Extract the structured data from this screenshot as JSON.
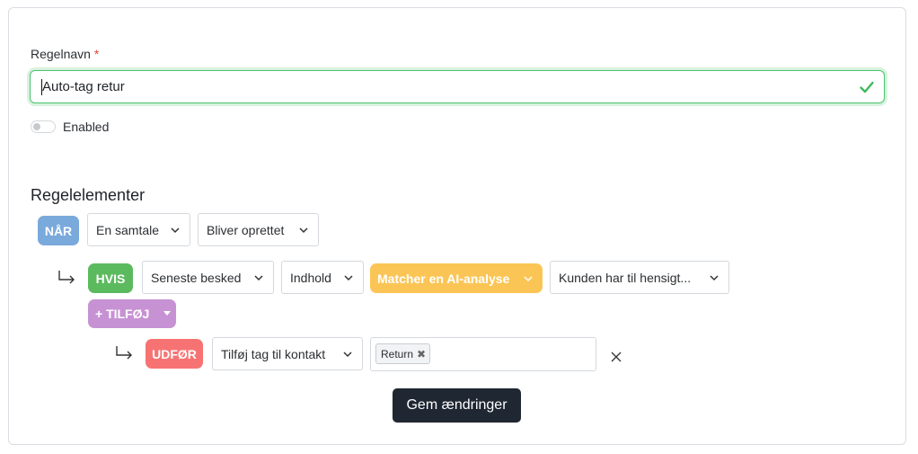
{
  "form": {
    "name_label": "Regelnavn",
    "required_mark": "*",
    "name_value": "Auto-tag retur",
    "enabled_label": "Enabled",
    "enabled": false
  },
  "rules": {
    "section_title": "Regelelementer",
    "when": {
      "badge": "NÅR",
      "subject": "En samtale",
      "event": "Bliver oprettet"
    },
    "condition": {
      "badge": "HVIS",
      "field": "Seneste besked",
      "property": "Indhold",
      "operator": "Matcher en AI-analyse",
      "value": "Kunden har til hensigt..."
    },
    "add_button": "+ TILFØJ",
    "action": {
      "badge": "UDFØR",
      "type": "Tilføj tag til kontakt",
      "tags": [
        "Return"
      ]
    }
  },
  "save_label": "Gem ændringer",
  "colors": {
    "when": "#7aa9dc",
    "if": "#5cba5e",
    "operator": "#fbc556",
    "add": "#c792d4",
    "do": "#f77373",
    "valid": "#4cc26f",
    "save": "#1f2732"
  }
}
